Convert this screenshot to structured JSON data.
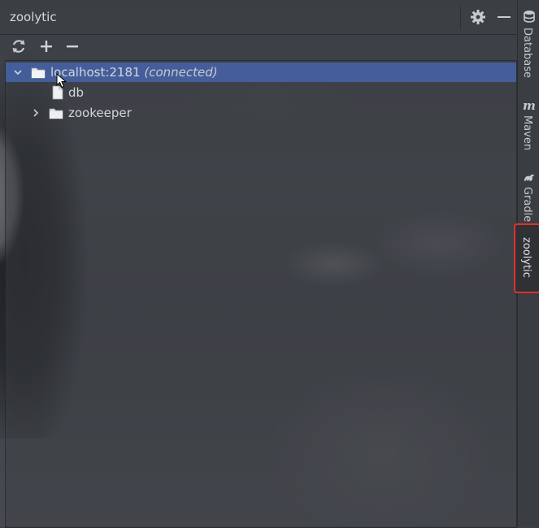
{
  "window": {
    "title": "zoolytic"
  },
  "titlebar": {
    "settings_icon": "gear-icon",
    "minimize_icon": "minus-icon"
  },
  "toolbar": {
    "refresh_icon": "refresh-icon",
    "add_icon": "plus-icon",
    "remove_icon": "minus-icon"
  },
  "tree": {
    "nodes": [
      {
        "label": "localhost:2181",
        "status": "(connected)",
        "expanded": true,
        "selected": true,
        "icon": "folder-icon"
      },
      {
        "label": "db",
        "icon": "file-icon"
      },
      {
        "label": "zookeeper",
        "expanded": false,
        "icon": "folder-icon"
      }
    ]
  },
  "side_tabs": [
    {
      "label": "Database",
      "icon": "database-icon"
    },
    {
      "label": "Maven",
      "icon": "maven-icon"
    },
    {
      "label": "Gradle",
      "icon": "gradle-icon"
    },
    {
      "label": "zoolytic",
      "active": true
    }
  ],
  "colors": {
    "selection": "#4664aa",
    "highlight_border": "#e0302f"
  }
}
